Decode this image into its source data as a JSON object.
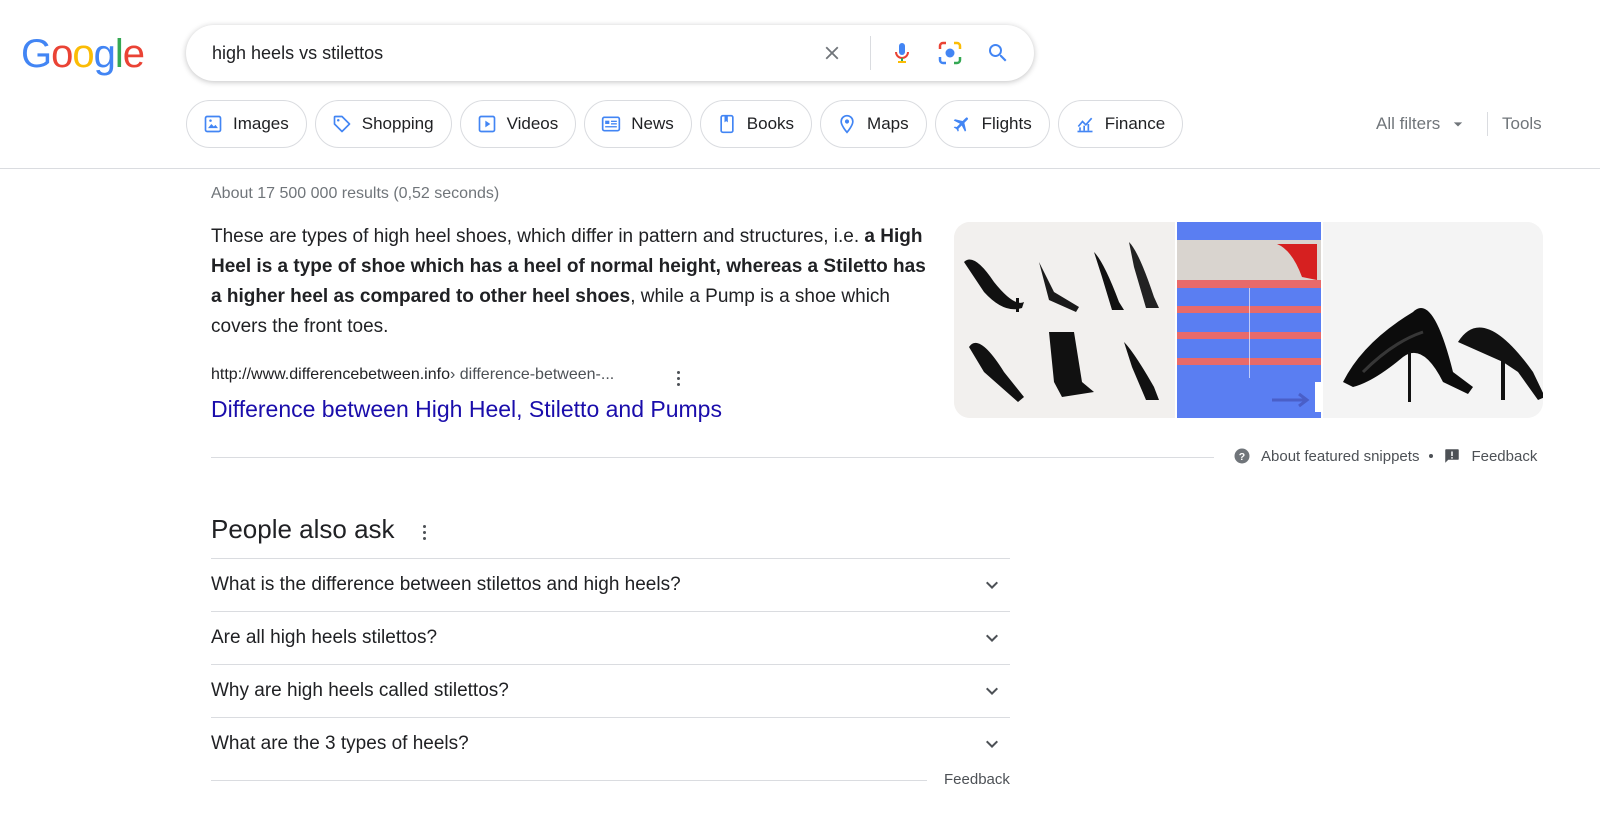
{
  "logo": {
    "letters": [
      "G",
      "o",
      "o",
      "g",
      "l",
      "e"
    ],
    "colors": [
      "#4285F4",
      "#EA4335",
      "#FBBC05",
      "#4285F4",
      "#34A853",
      "#EA4335"
    ]
  },
  "search": {
    "query": "high heels vs stilettos"
  },
  "tabs": [
    {
      "label": "Images",
      "icon": "image-icon"
    },
    {
      "label": "Shopping",
      "icon": "tag-icon"
    },
    {
      "label": "Videos",
      "icon": "play-icon"
    },
    {
      "label": "News",
      "icon": "newspaper-icon"
    },
    {
      "label": "Books",
      "icon": "book-icon"
    },
    {
      "label": "Maps",
      "icon": "location-pin-icon"
    },
    {
      "label": "Flights",
      "icon": "airplane-icon"
    },
    {
      "label": "Finance",
      "icon": "chart-icon"
    }
  ],
  "tools": {
    "all_filters": "All filters",
    "tools": "Tools"
  },
  "results": {
    "stats": "About 17 500 000 results (0,52 seconds)",
    "snippet": {
      "text_1": "These are types of high heel shoes, which differ in pattern and structures, i.e. ",
      "bold": "a High Heel is a type of shoe which has a heel of normal height, whereas a Stiletto has a higher heel as compared to other heel shoes",
      "text_2": ", while a Pump is a shoe which covers the front toes.",
      "cite_domain": "http://www.differencebetween.info",
      "cite_path": " › difference-between-...",
      "title": "Difference between High Heel, Stiletto and Pumps"
    },
    "about_snippets": "About featured snippets",
    "feedback": "Feedback"
  },
  "paa": {
    "title": "People also ask",
    "questions": [
      "What is the difference between stilettos and high heels?",
      "Are all high heels stilettos?",
      "Why are high heels called stilettos?",
      "What are the 3 types of heels?"
    ],
    "feedback": "Feedback"
  },
  "colors": {
    "link": "#1a0dab",
    "accent_blue": "#4285F4",
    "text": "#202124",
    "muted": "#70757a"
  }
}
